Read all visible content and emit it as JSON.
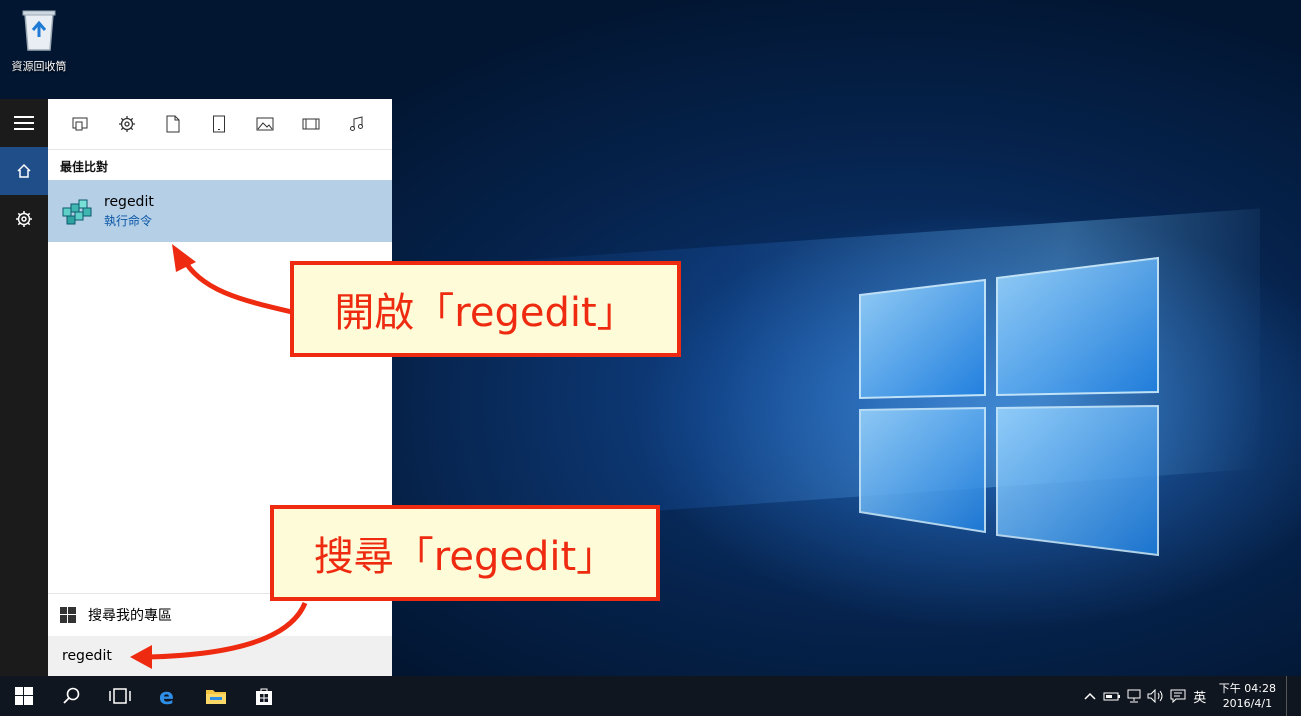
{
  "desktop": {
    "recycle_bin_label": "資源回收筒"
  },
  "rail": {
    "icons": [
      "hamburger-icon",
      "home-icon",
      "settings-icon"
    ]
  },
  "filters": [
    "apps-icon",
    "settings-icon",
    "document-icon",
    "tablet-icon",
    "photo-icon",
    "video-icon",
    "music-icon"
  ],
  "results": {
    "section_title": "最佳比對",
    "best_match": {
      "name": "regedit",
      "subtitle": "執行命令"
    }
  },
  "search": {
    "my_stuff_label": "搜尋我的專區",
    "query": "regedit"
  },
  "taskbar": {
    "ime": "英",
    "time": "下午 04:28",
    "date": "2016/4/1"
  },
  "callouts": {
    "open": "開啟「regedit」",
    "search": "搜尋「regedit」"
  },
  "colors": {
    "accent": "#1f4e89",
    "selection": "#b5cfe6",
    "callout_border": "#ee2b10",
    "callout_bg": "#fefbd8"
  }
}
